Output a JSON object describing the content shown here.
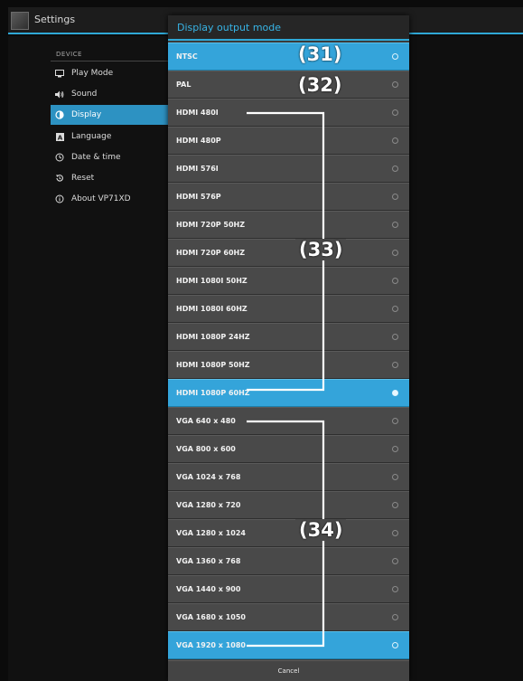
{
  "app": {
    "title": "Settings"
  },
  "sidebar": {
    "section": "DEVICE",
    "items": [
      {
        "label": "Play Mode",
        "icon": "monitor-icon"
      },
      {
        "label": "Sound",
        "icon": "speaker-icon"
      },
      {
        "label": "Display",
        "icon": "display-icon",
        "selected": true
      },
      {
        "label": "Language",
        "icon": "language-icon"
      },
      {
        "label": "Date & time",
        "icon": "clock-icon"
      },
      {
        "label": "Reset",
        "icon": "reset-icon"
      },
      {
        "label": "About VP71XD",
        "icon": "info-icon"
      }
    ]
  },
  "dialog": {
    "title": "Display output mode",
    "cancel_label": "Cancel",
    "options": [
      {
        "label": "NTSC",
        "highlighted": true,
        "checked": false
      },
      {
        "label": "PAL",
        "highlighted": false,
        "checked": false
      },
      {
        "label": "HDMI 480I",
        "highlighted": false,
        "checked": false
      },
      {
        "label": "HDMI 480P",
        "highlighted": false,
        "checked": false
      },
      {
        "label": "HDMI 576I",
        "highlighted": false,
        "checked": false
      },
      {
        "label": "HDMI 576P",
        "highlighted": false,
        "checked": false
      },
      {
        "label": "HDMI 720P 50HZ",
        "highlighted": false,
        "checked": false
      },
      {
        "label": "HDMI 720P 60HZ",
        "highlighted": false,
        "checked": false
      },
      {
        "label": "HDMI 1080I 50HZ",
        "highlighted": false,
        "checked": false
      },
      {
        "label": "HDMI 1080I 60HZ",
        "highlighted": false,
        "checked": false
      },
      {
        "label": "HDMI 1080P 24HZ",
        "highlighted": false,
        "checked": false
      },
      {
        "label": "HDMI 1080P 50HZ",
        "highlighted": false,
        "checked": false
      },
      {
        "label": "HDMI 1080P 60HZ",
        "highlighted": true,
        "checked": true
      },
      {
        "label": "VGA 640 x 480",
        "highlighted": false,
        "checked": false
      },
      {
        "label": "VGA 800 x 600",
        "highlighted": false,
        "checked": false
      },
      {
        "label": "VGA 1024 x 768",
        "highlighted": false,
        "checked": false
      },
      {
        "label": "VGA 1280 x 720",
        "highlighted": false,
        "checked": false
      },
      {
        "label": "VGA 1280 x 1024",
        "highlighted": false,
        "checked": false
      },
      {
        "label": "VGA 1360 x 768",
        "highlighted": false,
        "checked": false
      },
      {
        "label": "VGA 1440 x 900",
        "highlighted": false,
        "checked": false
      },
      {
        "label": "VGA 1680 x 1050",
        "highlighted": false,
        "checked": false
      },
      {
        "label": "VGA 1920 x 1080",
        "highlighted": true,
        "checked": false
      }
    ]
  },
  "callouts": [
    "(31)",
    "(32)",
    "(33)",
    "(34)"
  ],
  "colors": {
    "accent": "#2fa8d6",
    "highlight": "#34a4da",
    "title_text": "#37b4e6"
  }
}
